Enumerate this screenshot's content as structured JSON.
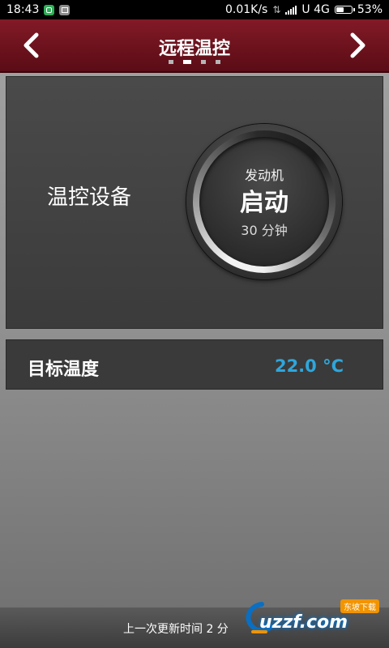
{
  "status_bar": {
    "time": "18:43",
    "net_speed": "0.01K/s",
    "carrier": "U 4G",
    "battery_percent": "53%",
    "battery_level": 0.53,
    "icons": [
      "shield-app-icon",
      "image-app-icon",
      "sync-icon",
      "signal-icon",
      "battery-icon"
    ]
  },
  "header": {
    "title": "远程温控",
    "page_count": 4,
    "active_page": 2,
    "background_color": "#821a26"
  },
  "control": {
    "device_label": "温控设备",
    "start_button": {
      "top_label": "发动机",
      "main_label": "启动",
      "duration": "30 分钟"
    }
  },
  "target_temp": {
    "label": "目标温度",
    "value": "22.0 °C",
    "value_color": "#2ea6dc"
  },
  "footer": {
    "last_update": "上一次更新时间 2 分"
  },
  "watermark": {
    "site": "uzzf.com",
    "tag": "东坡下载"
  }
}
